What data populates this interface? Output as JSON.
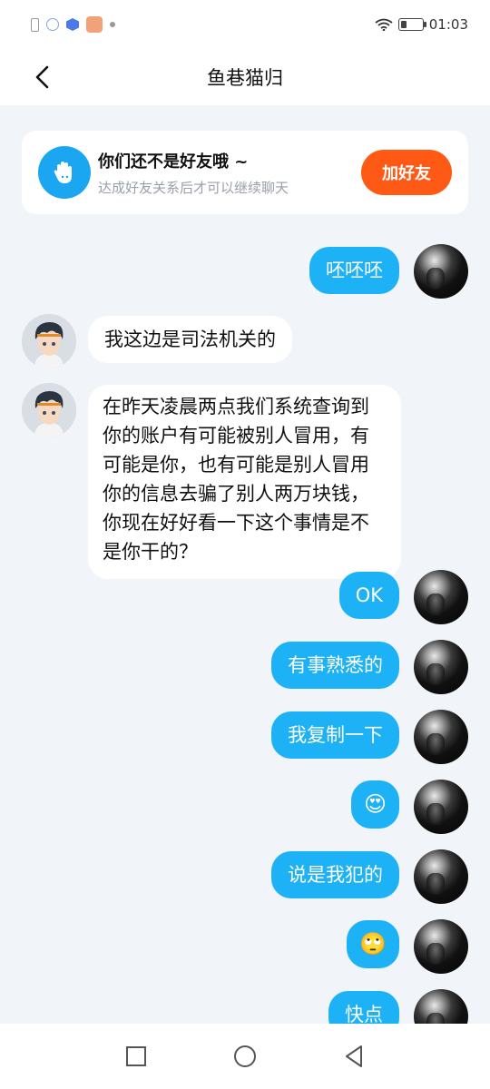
{
  "status_bar": {
    "time": "01:03",
    "icons": [
      "battery-saver-icon",
      "messenger-icon",
      "shield-app-icon",
      "app-icon",
      "dot-icon",
      "wifi-icon",
      "battery-icon"
    ]
  },
  "header": {
    "title": "鱼巷猫归",
    "back_icon": "chevron-left-icon"
  },
  "friend_banner": {
    "icon": "waving-hand-icon",
    "title": "你们还不是好友哦 ~",
    "subtitle": "达成好友关系后才可以继续聊天",
    "button_label": "加好友",
    "button_color": "#fe5a16",
    "icon_color": "#1ba6f2"
  },
  "messages": [
    {
      "side": "out",
      "text": "呸呸呸"
    },
    {
      "side": "in",
      "text": "我这边是司法机关的"
    },
    {
      "side": "in",
      "text": "在昨天凌晨两点我们系统查询到你的账户有可能被别人冒用，有可能是你，也有可能是别人冒用你的信息去骗了别人两万块钱，你现在好好看一下这个事情是不是你干的？"
    },
    {
      "side": "out",
      "text": "OK"
    },
    {
      "side": "out",
      "text": "有事熟悉的"
    },
    {
      "side": "out",
      "text": "我复制一下"
    },
    {
      "side": "out",
      "text": "😍"
    },
    {
      "side": "out",
      "text": "说是我犯的"
    },
    {
      "side": "out",
      "text": "🙄"
    },
    {
      "side": "out",
      "text": "快点"
    }
  ],
  "colors": {
    "outgoing_bubble": "#1db1f5",
    "incoming_bubble": "#ffffff",
    "background": "#f1f4f8"
  },
  "nav_bar": {
    "icons": [
      "square-recents-icon",
      "circle-home-icon",
      "triangle-back-icon"
    ]
  }
}
